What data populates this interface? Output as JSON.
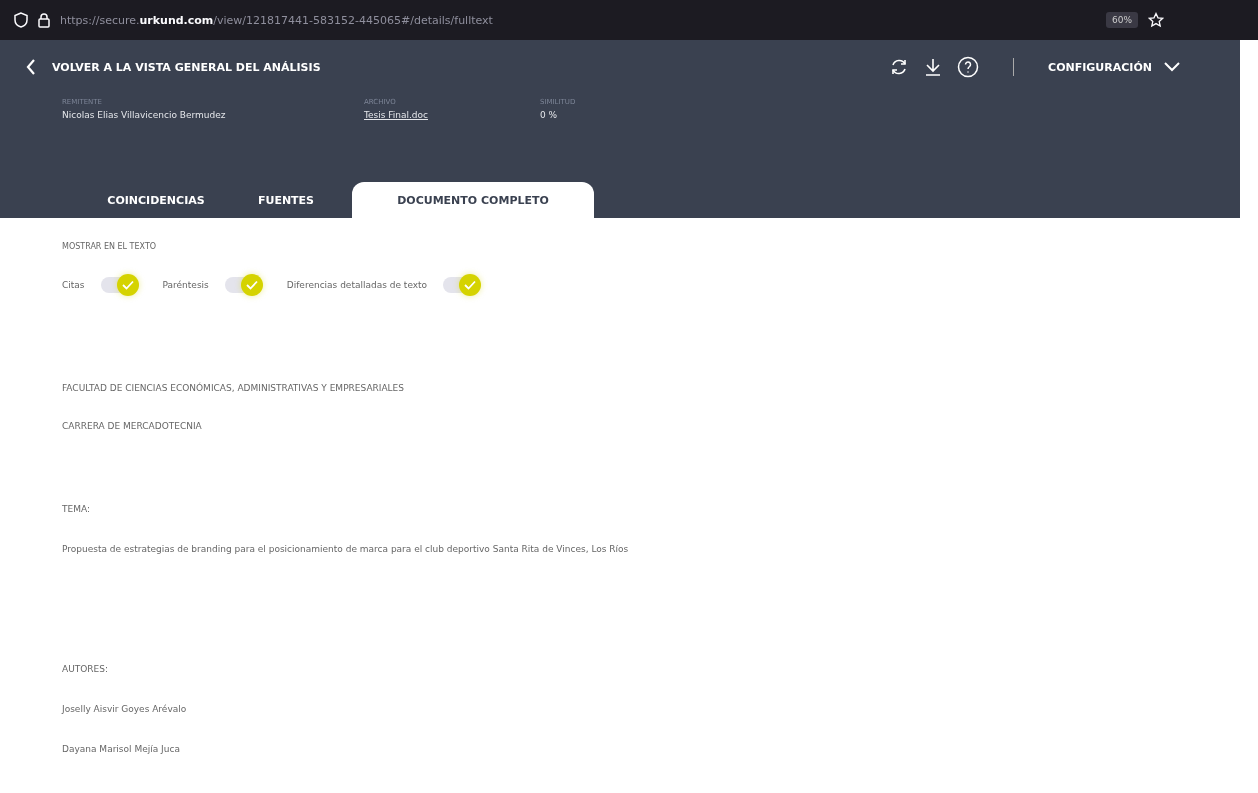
{
  "browser": {
    "url_prefix": "https://secure.",
    "url_domain": "urkund.com",
    "url_rest": "/view/121817441-583152-445065#/details/fulltext",
    "zoom": "60%"
  },
  "header": {
    "back_label": "VOLVER A LA VISTA GENERAL DEL ANÁLISIS",
    "settings_label": "CONFIGURACIÓN",
    "meta": [
      {
        "label": "REMITENTE",
        "value": "Nicolas Elias Villavicencio Bermudez",
        "kind": "text"
      },
      {
        "label": "ARCHIVO",
        "value": "Tesis Final.doc",
        "kind": "link"
      },
      {
        "label": "SIMILITUD",
        "value": "0 %",
        "kind": "text"
      }
    ]
  },
  "tabs": [
    {
      "label": "COINCIDENCIAS",
      "selected": false
    },
    {
      "label": "FUENTES",
      "selected": false
    },
    {
      "label": "DOCUMENTO COMPLETO",
      "selected": true
    }
  ],
  "show_in_text": {
    "title": "MOSTRAR EN EL TEXTO",
    "toggles": [
      {
        "label": "Citas",
        "on": true
      },
      {
        "label": "Paréntesis",
        "on": true
      },
      {
        "label": "Diferencias detalladas de texto",
        "on": true
      }
    ]
  },
  "document": {
    "paragraphs": [
      "FACULTAD DE CIENCIAS ECONÓMICAS, ADMINISTRATIVAS Y EMPRESARIALES",
      "CARRERA DE MERCADOTECNIA",
      "TEMA:",
      "Propuesta de estrategias de branding para el posicionamiento de marca para el club deportivo Santa Rita de Vinces, Los Ríos",
      "AUTORES:",
      "Joselly Aisvir Goyes Arévalo",
      "Dayana Marisol Mejía Juca"
    ]
  }
}
